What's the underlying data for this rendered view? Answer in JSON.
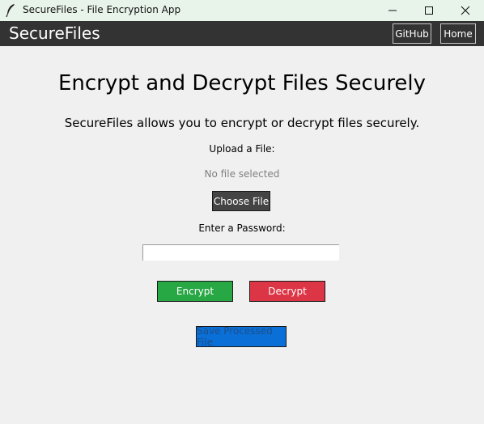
{
  "window": {
    "title": "SecureFiles - File Encryption App",
    "app_icon": "feather-icon",
    "controls": {
      "minimize": "minimize-icon",
      "maximize": "maximize-icon",
      "close": "close-icon"
    }
  },
  "header": {
    "brand": "SecureFiles",
    "nav": {
      "github": "GitHub",
      "home": "Home"
    },
    "background": "#333333"
  },
  "main": {
    "heading": "Encrypt and Decrypt Files Securely",
    "subtitle": "SecureFiles allows you to encrypt or decrypt files securely.",
    "upload_label": "Upload a File:",
    "file_status": "No file selected",
    "choose_file": "Choose File",
    "password_label": "Enter a Password:",
    "password_value": "",
    "encrypt": "Encrypt",
    "decrypt": "Decrypt",
    "save": "Save Processed File",
    "save_enabled": false
  },
  "colors": {
    "encrypt": "#28a745",
    "decrypt": "#dc3545",
    "save": "#0a6fd6",
    "choose": "#444444"
  }
}
